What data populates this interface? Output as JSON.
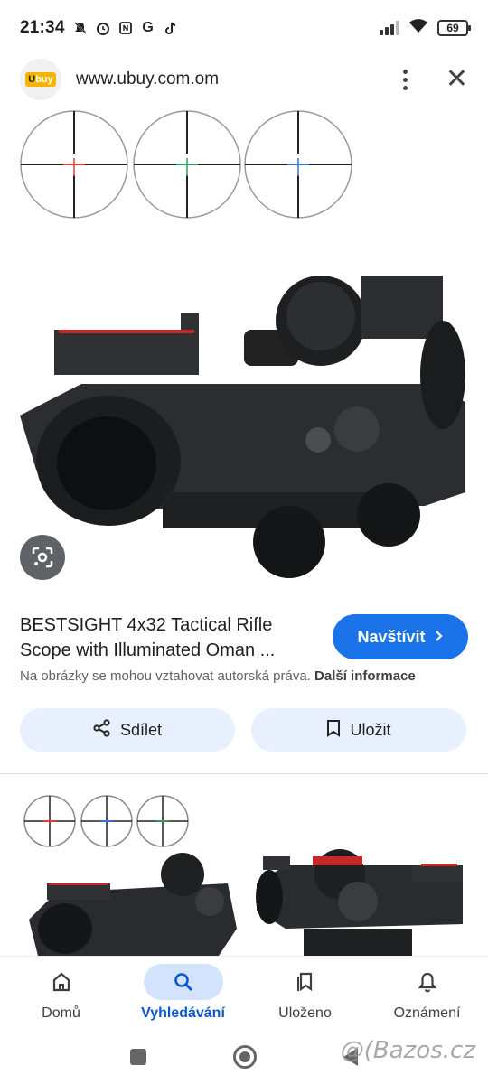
{
  "status_bar": {
    "time": "21:34",
    "battery": "69",
    "left_icons": [
      "mute-icon",
      "alarm-icon",
      "nfc-icon",
      "google-icon",
      "tiktok-icon"
    ]
  },
  "header": {
    "logo_text_1": "U",
    "logo_text_2": "buy",
    "url": "www.ubuy.com.om"
  },
  "result": {
    "title": "BESTSIGHT 4x32 Tactical Rifle Scope with Illuminated Oman ...",
    "visit_label": "Navštívit",
    "copyright_text": "Na obrázky se mohou vztahovat autorská práva.",
    "more_info_label": "Další informace",
    "share_label": "Sdílet",
    "save_label": "Uložit"
  },
  "bottom_nav": {
    "items": [
      {
        "label": "Domů",
        "icon": "home-icon"
      },
      {
        "label": "Vyhledávání",
        "icon": "search-icon"
      },
      {
        "label": "Uloženo",
        "icon": "bookmarks-icon"
      },
      {
        "label": "Oznámení",
        "icon": "bell-icon"
      }
    ],
    "active": "Vyhledávání"
  },
  "watermark": "@(Bazos.cz",
  "colors": {
    "accent": "#1a73e8",
    "chip_bg": "#e8f0fe",
    "active_nav_bg": "#d3e3fd"
  }
}
